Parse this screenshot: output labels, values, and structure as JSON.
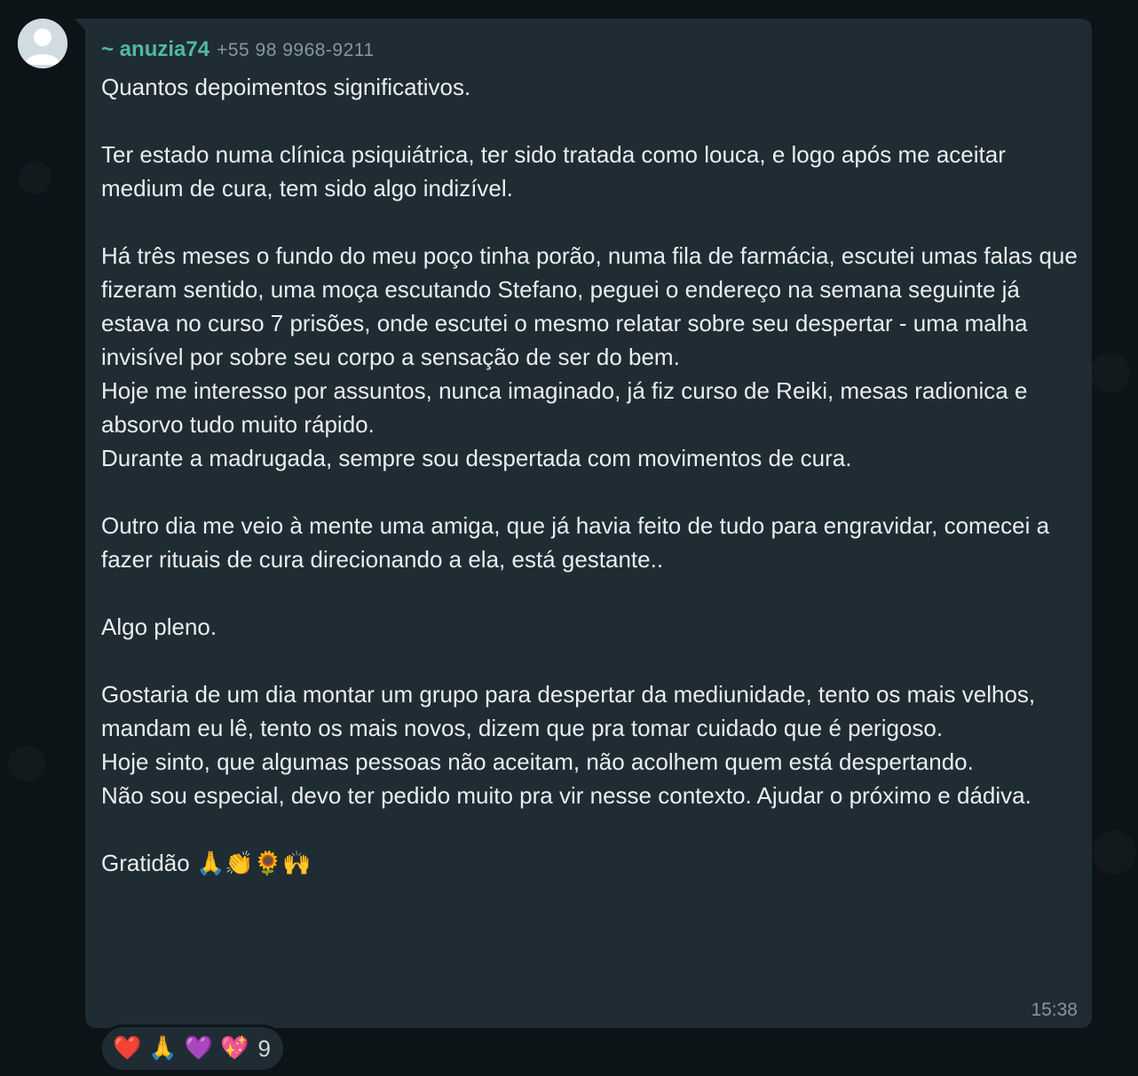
{
  "sender": {
    "name": "~ anuzia74",
    "phone": "+55 98 9968-9211"
  },
  "message": {
    "paragraphs": [
      "Quantos depoimentos significativos.",
      "",
      "Ter estado numa clínica psiquiátrica, ter sido tratada como louca, e logo após me aceitar medium de cura, tem sido algo indizível.",
      "",
      "Há três meses o fundo do meu poço tinha porão, numa fila de farmácia, escutei umas falas que fizeram sentido, uma moça escutando Stefano, peguei o endereço na semana seguinte já estava no curso 7 prisões, onde escutei o mesmo relatar sobre seu despertar - uma malha invisível por sobre seu corpo a sensação de ser do bem.",
      "Hoje me interesso por assuntos, nunca imaginado, já fiz curso de Reiki, mesas radionica e absorvo tudo muito rápido.",
      "Durante a madrugada, sempre sou despertada com movimentos de cura.",
      "",
      "Outro dia me veio à mente uma amiga, que já havia feito de tudo para engravidar, comecei a fazer rituais de cura direcionando a ela, está gestante..",
      "",
      "Algo pleno.",
      "",
      "Gostaria de um dia montar um grupo para despertar da mediunidade, tento os mais velhos, mandam eu lê, tento os mais novos, dizem que pra tomar cuidado que é perigoso.",
      "Hoje sinto, que algumas pessoas não aceitam, não acolhem quem está despertando.",
      "Não sou especial, devo ter pedido muito pra vir nesse contexto. Ajudar o próximo e dádiva.",
      ""
    ],
    "closing": "Gratidão",
    "closing_emojis": [
      "🙏",
      "👏",
      "🌻",
      "🙌"
    ],
    "time": "15:38"
  },
  "reactions": {
    "emojis": [
      "❤️",
      "🙏",
      "💜",
      "💖"
    ],
    "count": "9"
  },
  "colors": {
    "bubble": "#202c33",
    "background": "#0d1418",
    "sender_name": "#4fb8a6",
    "text": "#e9edef",
    "meta": "#8696a0"
  },
  "icons": {
    "avatar": "default-user-avatar-icon"
  }
}
